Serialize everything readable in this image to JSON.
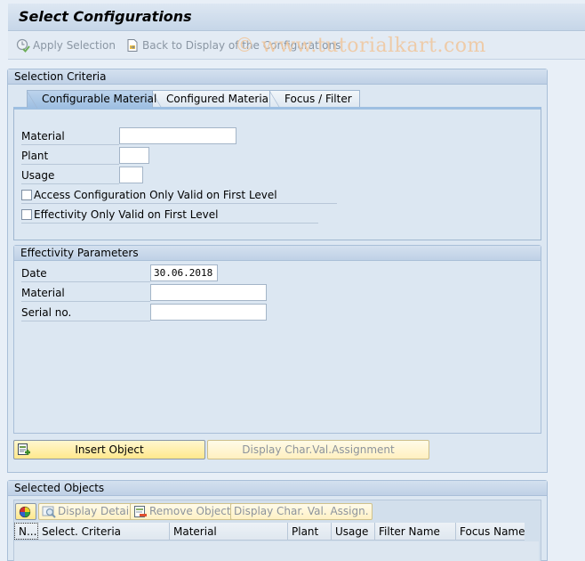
{
  "window": {
    "title": "Select Configurations"
  },
  "toolbar": {
    "apply_selection": {
      "label": "Apply Selection",
      "icon": "clock-check-icon",
      "enabled": false
    },
    "back_to_display": {
      "label": "Back to Display of the Configurations",
      "icon": "document-arrow-icon",
      "enabled": false
    },
    "watermark": "© www.tutorialkart.com"
  },
  "selection_criteria": {
    "title": "Selection Criteria",
    "tabs": [
      {
        "label": "Configurable Material",
        "active": true
      },
      {
        "label": "Configured Material",
        "active": false
      },
      {
        "label": "Focus / Filter",
        "active": false
      }
    ],
    "fields": {
      "material": {
        "label": "Material",
        "value": ""
      },
      "plant": {
        "label": "Plant",
        "value": ""
      },
      "usage": {
        "label": "Usage",
        "value": ""
      }
    },
    "checkboxes": [
      {
        "label": "Access Configuration Only Valid on First Level",
        "checked": false
      },
      {
        "label": "Effectivity Only Valid on First Level",
        "checked": false
      }
    ],
    "effectivity": {
      "title": "Effectivity Parameters",
      "date": {
        "label": "Date",
        "value": "30.06.2018"
      },
      "material": {
        "label": "Material",
        "value": ""
      },
      "serial_no": {
        "label": "Serial no.",
        "value": ""
      }
    },
    "buttons": {
      "insert_object": {
        "label": "Insert Object",
        "icon": "insert-object-icon",
        "enabled": true
      },
      "display_char_val": {
        "label": "Display Char.Val.Assignment",
        "enabled": false
      }
    }
  },
  "selected_objects": {
    "title": "Selected Objects",
    "toolbar": {
      "color_legend": {
        "icon": "color-wheel-icon"
      },
      "display_details": {
        "label": "Display Details",
        "icon": "magnifier-icon",
        "enabled": false
      },
      "remove_object": {
        "label": "Remove Object",
        "icon": "remove-object-icon",
        "enabled": false
      },
      "display_char_val_assign": {
        "label": "Display Char. Val. Assign.",
        "enabled": false
      }
    },
    "columns": [
      "N...",
      "Select. Criteria",
      "Material",
      "Plant",
      "Usage",
      "Filter Name",
      "Focus Name"
    ],
    "rows": []
  }
}
